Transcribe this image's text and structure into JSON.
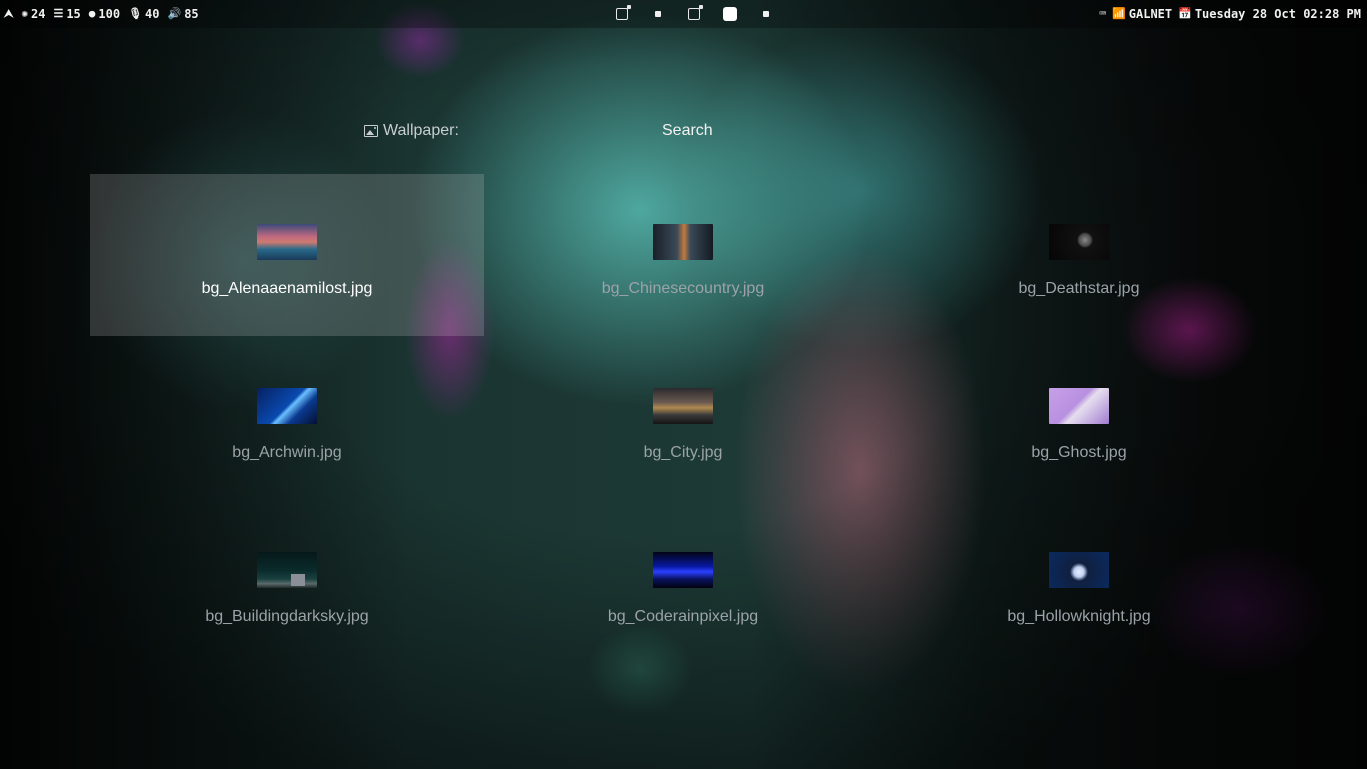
{
  "topbar": {
    "left": [
      {
        "icon": "arch-logo-icon",
        "glyph": "⮝",
        "value": ""
      },
      {
        "icon": "cpu-icon",
        "glyph": "✺",
        "value": "24"
      },
      {
        "icon": "memory-icon",
        "glyph": "☰",
        "value": "15"
      },
      {
        "icon": "battery-icon",
        "glyph": "●",
        "value": "100"
      },
      {
        "icon": "microphone-icon",
        "glyph": "🎙",
        "value": "40"
      },
      {
        "icon": "volume-icon",
        "glyph": "🔊",
        "value": "85"
      }
    ],
    "workspaces": [
      {
        "state": "occupied"
      },
      {
        "state": "empty"
      },
      {
        "state": "occupied"
      },
      {
        "state": "active"
      },
      {
        "state": "empty"
      }
    ],
    "keyboard_glyph": "⌨",
    "wifi_glyph": "📶",
    "network": "GALNET",
    "calendar_glyph": "📅",
    "datetime": "Tuesday 28 Oct 02:28 PM"
  },
  "picker": {
    "prompt": "Wallpaper:",
    "search_placeholder": "Search",
    "selected_index": 0,
    "items": [
      {
        "name": "bg_Alenaaenamilost.jpg",
        "thumb": "alena"
      },
      {
        "name": "bg_Chinesecountry.jpg",
        "thumb": "china"
      },
      {
        "name": "bg_Deathstar.jpg",
        "thumb": "death"
      },
      {
        "name": "bg_Archwin.jpg",
        "thumb": "arch"
      },
      {
        "name": "bg_City.jpg",
        "thumb": "city"
      },
      {
        "name": "bg_Ghost.jpg",
        "thumb": "ghost"
      },
      {
        "name": "bg_Buildingdarksky.jpg",
        "thumb": "build"
      },
      {
        "name": "bg_Coderainpixel.jpg",
        "thumb": "code"
      },
      {
        "name": "bg_Hollowknight.jpg",
        "thumb": "hollow"
      }
    ]
  }
}
